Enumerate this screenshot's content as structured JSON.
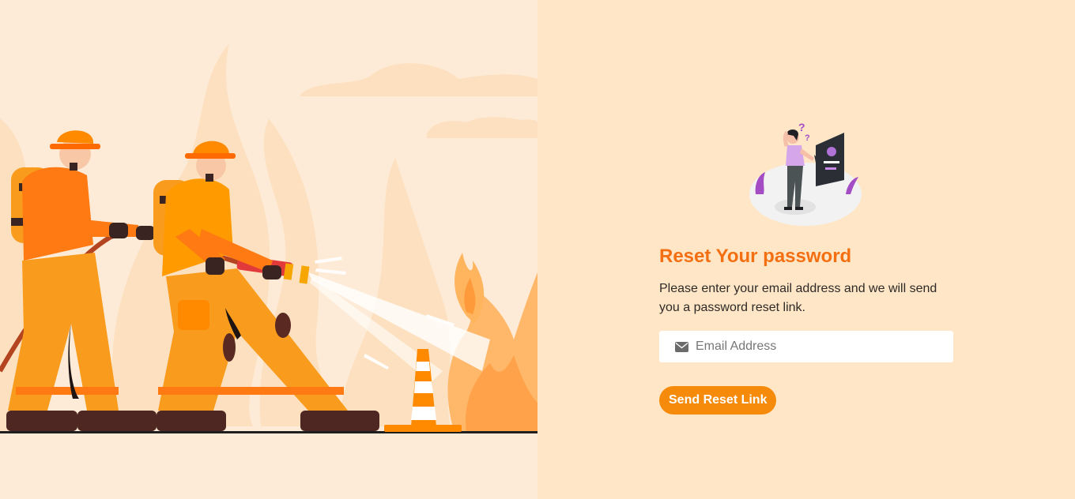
{
  "hero": {
    "scene": "firefighters-hose-illustration"
  },
  "illustration": {
    "scene": "forgot-password-illustration"
  },
  "reset": {
    "title": "Reset Your password",
    "description": "Please enter your email address and we will send you a password reset link.",
    "email_placeholder": "Email Address",
    "email_value": "",
    "email_icon": "envelope-icon",
    "submit_label": "Send Reset Link"
  },
  "colors": {
    "accent": "#f36f12",
    "button": "#f58a0b",
    "right_bg": "#fee6c7",
    "left_bg": "#fdebd7"
  }
}
